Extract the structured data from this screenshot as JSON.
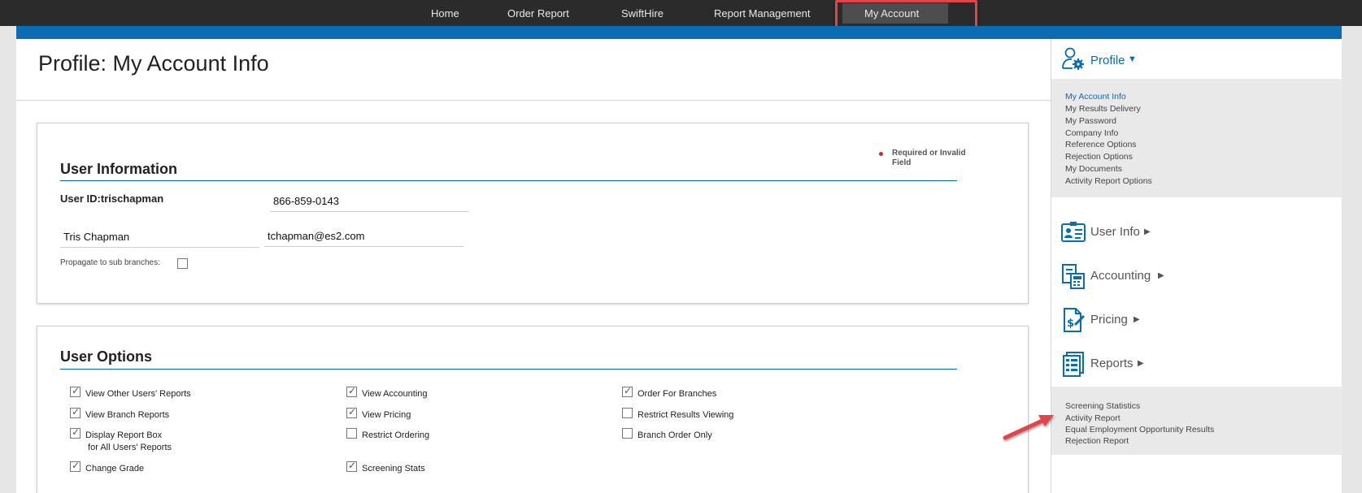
{
  "nav": {
    "items": [
      {
        "label": "Home"
      },
      {
        "label": "Order Report"
      },
      {
        "label": "SwiftHire"
      },
      {
        "label": "Report Management"
      },
      {
        "label": "My Account"
      }
    ]
  },
  "page": {
    "title": "Profile: My Account Info"
  },
  "user_info": {
    "section_title": "User Information",
    "required_note": "Required or Invalid Field",
    "user_id_label": "User ID:trischapman",
    "phone_value": "866-859-0143",
    "name_value": "Tris Chapman",
    "email_value": "tchapman@es2.com",
    "propagate_label": "Propagate to sub branches:",
    "propagate_checked": false
  },
  "user_options": {
    "section_title": "User Options",
    "col1": [
      {
        "label": "View Other Users' Reports",
        "checked": true
      },
      {
        "label": "View Branch Reports",
        "checked": true
      },
      {
        "label": "Display Report Box\n for All Users' Reports",
        "checked": true
      },
      {
        "label": "Change Grade",
        "checked": true
      }
    ],
    "col2": [
      {
        "label": "View Accounting",
        "checked": true
      },
      {
        "label": "View Pricing",
        "checked": true
      },
      {
        "label": "Restrict Ordering",
        "checked": false
      },
      {
        "label": "Screening Stats",
        "checked": true
      }
    ],
    "col3": [
      {
        "label": "Order For Branches",
        "checked": true
      },
      {
        "label": "Restrict Results Viewing",
        "checked": false
      },
      {
        "label": "Branch Order Only",
        "checked": false
      }
    ]
  },
  "sidebar": {
    "profile": {
      "label": "Profile",
      "items": [
        {
          "label": "My Account Info"
        },
        {
          "label": "My Results Delivery"
        },
        {
          "label": "My Password"
        },
        {
          "label": "Company Info"
        },
        {
          "label": "Reference Options"
        },
        {
          "label": "Rejection Options"
        },
        {
          "label": "My Documents"
        },
        {
          "label": "Activity Report Options"
        }
      ]
    },
    "sections": [
      {
        "label": "User Info",
        "icon": "id-card-icon"
      },
      {
        "label": "Accounting",
        "icon": "calculator-icon"
      },
      {
        "label": "Pricing",
        "icon": "price-tag-icon"
      },
      {
        "label": "Reports",
        "icon": "report-icon"
      }
    ],
    "reports_items": [
      {
        "label": "Screening Statistics"
      },
      {
        "label": "Activity Report"
      },
      {
        "label": "Equal Employment Opportunity Results"
      },
      {
        "label": "Rejection Report"
      }
    ]
  },
  "colors": {
    "accent": "#0a6cb3",
    "nav_bg": "#2b2b2b",
    "highlight": "#e0454b",
    "required": "#d9262c"
  }
}
